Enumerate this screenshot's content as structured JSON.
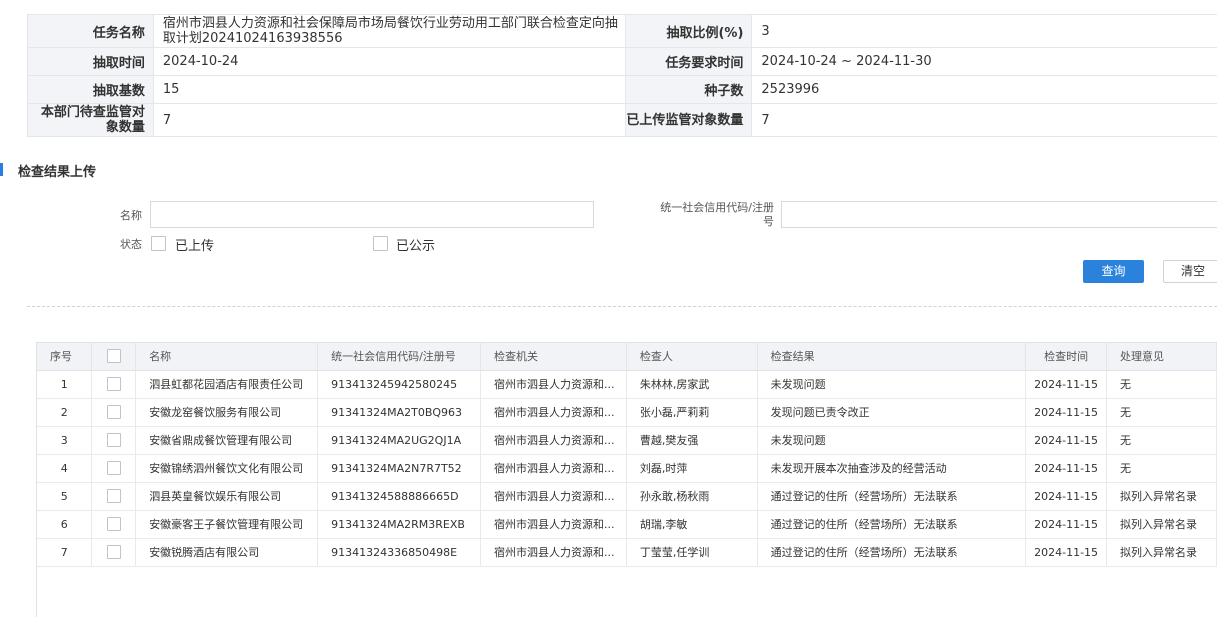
{
  "task_info": {
    "task_name_label": "任务名称",
    "task_name_value": "宿州市泗县人力资源和社会保障局市场局餐饮行业劳动用工部门联合检查定向抽取计划20241024163938556",
    "ratio_label": "抽取比例(%)",
    "ratio_value": "3",
    "draw_time_label": "抽取时间",
    "draw_time_value": "2024-10-24",
    "required_time_label": "任务要求时间",
    "required_time_value": "2024-10-24 ~ 2024-11-30",
    "base_count_label": "抽取基数",
    "base_count_value": "15",
    "seed_label": "种子数",
    "seed_value": "2523996",
    "pending_label": "本部门待查监管对象数量",
    "pending_value": "7",
    "uploaded_label": "已上传监管对象数量",
    "uploaded_value": "7"
  },
  "section_title": "检查结果上传",
  "search": {
    "name_label": "名称",
    "name_value": "",
    "credit_label": "统一社会信用代码/注册号",
    "credit_value": "",
    "status_label": "状态",
    "status_uploaded": "已上传",
    "status_published": "已公示",
    "query_button": "查询",
    "clear_button": "清空"
  },
  "table": {
    "headers": [
      "序号",
      "",
      "名称",
      "统一社会信用代码/注册号",
      "检查机关",
      "检查人",
      "检查结果",
      "检查时间",
      "处理意见"
    ],
    "rows": [
      [
        "1",
        "",
        "泗县虹都花园酒店有限责任公司",
        "913413245942580245",
        "宿州市泗县人力资源和...",
        "朱林林,房家武",
        "未发现问题",
        "2024-11-15",
        "无"
      ],
      [
        "2",
        "",
        "安徽龙窑餐饮服务有限公司",
        "91341324MA2T0BQ963",
        "宿州市泗县人力资源和...",
        "张小磊,严莉莉",
        "发现问题已责令改正",
        "2024-11-15",
        "无"
      ],
      [
        "3",
        "",
        "安徽省鼎成餐饮管理有限公司",
        "91341324MA2UG2QJ1A",
        "宿州市泗县人力资源和...",
        "曹越,樊友强",
        "未发现问题",
        "2024-11-15",
        "无"
      ],
      [
        "4",
        "",
        "安徽锦绣泗州餐饮文化有限公司",
        "91341324MA2N7R7T52",
        "宿州市泗县人力资源和...",
        "刘磊,时萍",
        "未发现开展本次抽查涉及的经营活动",
        "2024-11-15",
        "无"
      ],
      [
        "5",
        "",
        "泗县英皇餐饮娱乐有限公司",
        "91341324588886665D",
        "宿州市泗县人力资源和...",
        "孙永敢,杨秋雨",
        "通过登记的住所（经营场所）无法联系",
        "2024-11-15",
        "拟列入异常名录"
      ],
      [
        "6",
        "",
        "安徽豪客王子餐饮管理有限公司",
        "91341324MA2RM3REXB",
        "宿州市泗县人力资源和...",
        "胡瑞,李敏",
        "通过登记的住所（经营场所）无法联系",
        "2024-11-15",
        "拟列入异常名录"
      ],
      [
        "7",
        "",
        "安徽锐腾酒店有限公司",
        "913413243368504​98E",
        "宿州市泗县人力资源和...",
        "丁莹莹,任学训",
        "通过登记的住所（经营场所）无法联系",
        "2024-11-15",
        "拟列入异常名录"
      ]
    ]
  }
}
